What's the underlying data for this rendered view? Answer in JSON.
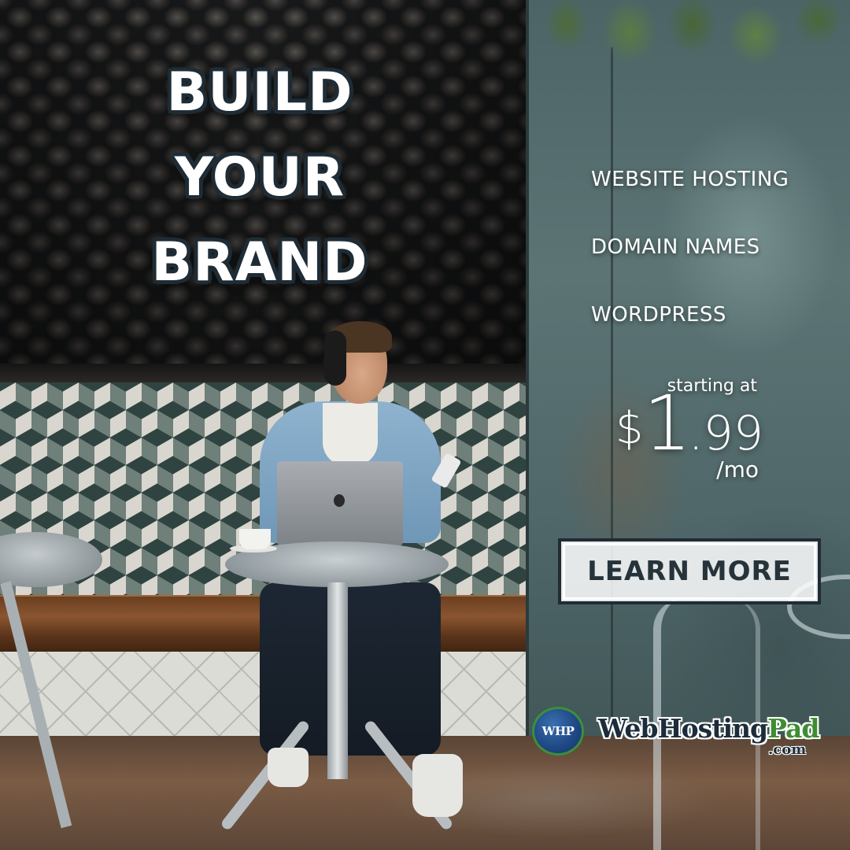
{
  "headline": {
    "lines": [
      "BUILD",
      "YOUR",
      "BRAND"
    ]
  },
  "features": {
    "items": [
      "WEBSITE HOSTING",
      "DOMAIN NAMES",
      "WORDPRESS"
    ]
  },
  "pricing": {
    "starting_label": "starting at",
    "currency_symbol": "$",
    "dollars": "1",
    "cents": ".99",
    "period": "/mo"
  },
  "cta": {
    "label": "LEARN MORE"
  },
  "brand": {
    "badge_text": "WHP",
    "name_primary": "WebHosting",
    "name_accent": "Pad",
    "domain": ".com",
    "colors": {
      "navy": "#1d2c3a",
      "green": "#3f8d33",
      "badge_blue": "#1f4a86"
    }
  },
  "colors": {
    "headline_text": "#ffffff",
    "headline_outline": "#1f2c35",
    "cta_text": "#26333b",
    "cta_border": "#1f2c35"
  }
}
